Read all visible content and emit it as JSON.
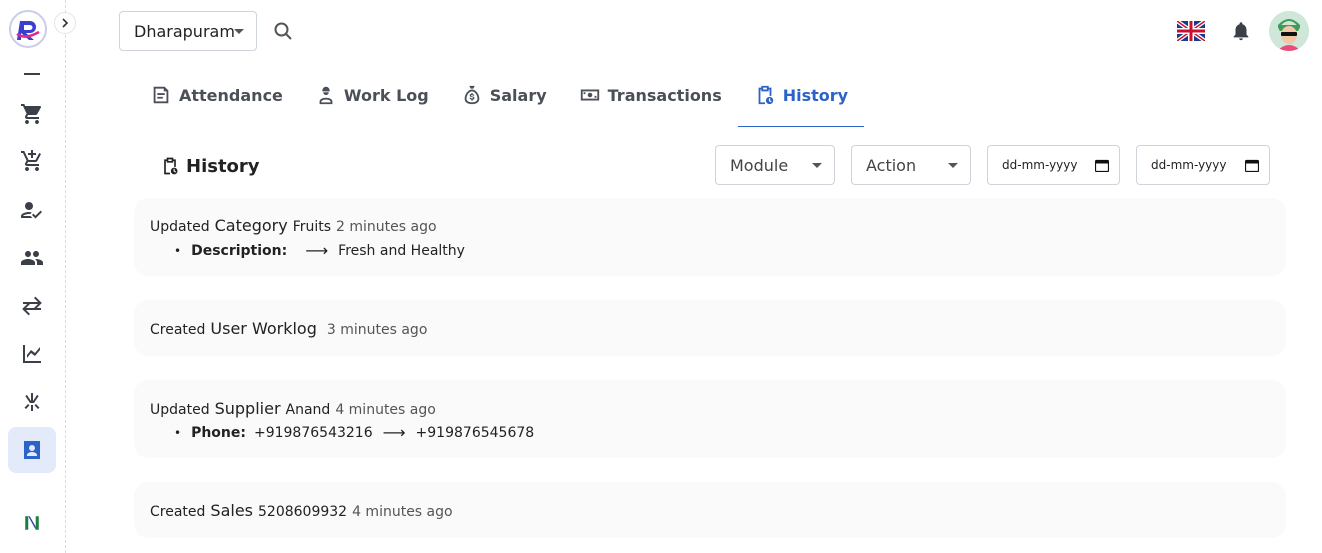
{
  "header": {
    "location": "Dharapuram"
  },
  "tabs": [
    {
      "label": "Attendance"
    },
    {
      "label": "Work Log"
    },
    {
      "label": "Salary"
    },
    {
      "label": "Transactions"
    },
    {
      "label": "History"
    }
  ],
  "history": {
    "heading": "History",
    "filters": {
      "module_placeholder": "Module",
      "action_placeholder": "Action",
      "from_date_placeholder": "dd-mm-yyyy",
      "to_date_placeholder": "dd-mm-yyyy"
    },
    "entries": [
      {
        "action": "Updated",
        "module": "Category",
        "entity": "Fruits",
        "time": "2 minutes ago",
        "changes": [
          {
            "field": "Description:",
            "old": "",
            "new": "Fresh and Healthy"
          }
        ]
      },
      {
        "action": "Created",
        "module": "User Worklog",
        "entity": "",
        "time": "3 minutes ago",
        "changes": []
      },
      {
        "action": "Updated",
        "module": "Supplier",
        "entity": "Anand",
        "time": "4 minutes ago",
        "changes": [
          {
            "field": "Phone:",
            "old": "+919876543216",
            "new": "+919876545678"
          }
        ]
      },
      {
        "action": "Created",
        "module": "Sales",
        "entity": "5208609932",
        "time": "4 minutes ago",
        "changes": []
      }
    ]
  },
  "colors": {
    "accent": "#2c63c8",
    "card_background": "#fafafa",
    "active_sidebar_bg": "#e3ebfb"
  },
  "icons": {
    "sidebar": [
      "dash-icon",
      "cart-icon",
      "cart-add-icon",
      "user-check-icon",
      "people-icon",
      "swap-icon",
      "chart-icon",
      "scissors-icon",
      "contact-card-icon",
      "brand-icon"
    ]
  }
}
